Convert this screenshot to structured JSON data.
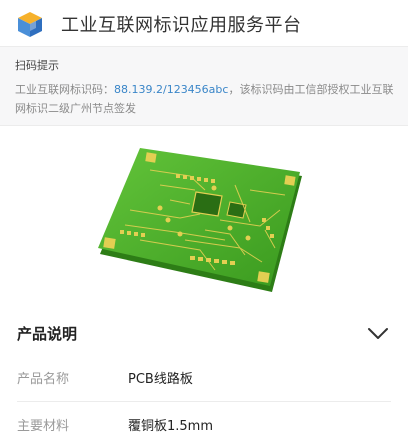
{
  "header": {
    "title": "工业互联网标识应用服务平台",
    "logo_icon": "cube-logo-icon"
  },
  "notice": {
    "title": "扫码提示",
    "text_prefix": "工业互联网标识码：",
    "identifier": "88.139.2/123456abc",
    "text_suffix": "，该标识码由工信部授权工业互联网标识二级广州节点签发"
  },
  "product_image": {
    "description_icon": "pcb-board-image"
  },
  "section": {
    "title": "产品说明",
    "toggle_icon": "chevron-down-icon"
  },
  "details": [
    {
      "label": "产品名称",
      "value": "PCB线路板"
    },
    {
      "label": "主要材料",
      "value": "覆铜板1.5mm"
    }
  ],
  "colors": {
    "link": "#3a86c8",
    "board_green": "#4fb32a",
    "board_gold": "#e3cf52"
  }
}
